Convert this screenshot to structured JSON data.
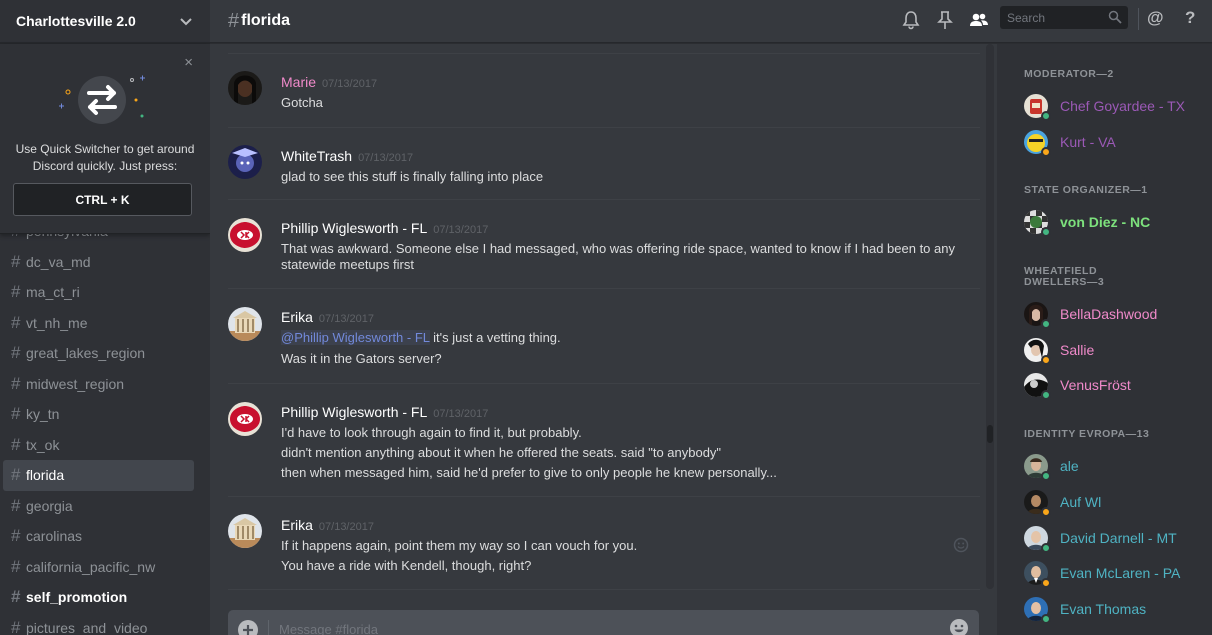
{
  "colors": {
    "online": "#43b581",
    "idle": "#faa61a",
    "moderator": "#9b59b6",
    "state_organizer": "#7de17d",
    "wheatfield": "#f08aca",
    "identity": "#4fb3c3",
    "marie": "#f08aca",
    "mention": "#7289da"
  },
  "guild": {
    "name": "Charlottesville 2.0",
    "chevron_icon": "chevron-down-icon"
  },
  "quick_switcher": {
    "close": "×",
    "text_line1": "Use Quick Switcher to get around",
    "text_line2": "Discord quickly. Just press:",
    "shortcut": "CTRL + K"
  },
  "channels": [
    {
      "name": "pennsylvania",
      "state": "normal"
    },
    {
      "name": "dc_va_md",
      "state": "normal"
    },
    {
      "name": "ma_ct_ri",
      "state": "normal"
    },
    {
      "name": "vt_nh_me",
      "state": "normal"
    },
    {
      "name": "great_lakes_region",
      "state": "normal"
    },
    {
      "name": "midwest_region",
      "state": "normal"
    },
    {
      "name": "ky_tn",
      "state": "normal"
    },
    {
      "name": "tx_ok",
      "state": "normal"
    },
    {
      "name": "florida",
      "state": "active"
    },
    {
      "name": "georgia",
      "state": "normal"
    },
    {
      "name": "carolinas",
      "state": "normal"
    },
    {
      "name": "california_pacific_nw",
      "state": "normal"
    },
    {
      "name": "self_promotion",
      "state": "unread"
    },
    {
      "name": "pictures_and_video",
      "state": "normal"
    }
  ],
  "header": {
    "hash": "#",
    "channel": "florida",
    "search_placeholder": "Search",
    "icons": [
      "bell-icon",
      "pin-icon",
      "members-icon",
      "search-icon",
      "mention-icon",
      "help-icon"
    ],
    "mention_symbol": "@",
    "help_symbol": "?"
  },
  "messages": [
    {
      "author": "Marie",
      "time": "07/13/2017",
      "avatar": "avatar-marie",
      "lines": [
        "Gotcha"
      ]
    },
    {
      "author": "WhiteTrash",
      "time": "07/13/2017",
      "avatar": "avatar-whitetrash",
      "lines": [
        "glad to see this stuff is finally falling into place"
      ]
    },
    {
      "author": "Phillip Wiglesworth - FL",
      "time": "07/13/2017",
      "avatar": "avatar-chiefs",
      "lines": [
        "That was awkward. Someone else I had messaged, who was offering ride space, wanted to know if I had been to any",
        "statewide meetups first"
      ]
    },
    {
      "author": "Erika",
      "time": "07/13/2017",
      "avatar": "avatar-erika",
      "mention": "@Phillip Wiglesworth - FL",
      "lines": [
        " it's just a vetting thing.",
        "Was it in the Gators server?"
      ]
    },
    {
      "author": "Phillip Wiglesworth - FL",
      "time": "07/13/2017",
      "avatar": "avatar-chiefs",
      "lines": [
        "I'd have to look through again to find it, but probably.",
        "didn't mention anything about it when he offered the seats.  said \"to anybody\"",
        "then when messaged him, said he'd prefer to give to only people he knew personally..."
      ]
    },
    {
      "author": "Erika",
      "time": "07/13/2017",
      "avatar": "avatar-erika",
      "lines": [
        "If it happens again, point them my way so I can vouch for you.",
        "You have a ride with Kendell, though, right?"
      ]
    }
  ],
  "composer": {
    "placeholder": "Message #florida"
  },
  "member_groups": [
    {
      "title": "MODERATOR—2",
      "members": [
        {
          "name": "Chef Goyardee - TX",
          "status": "online"
        },
        {
          "name": "Kurt - VA",
          "status": "idle"
        }
      ]
    },
    {
      "title": "STATE ORGANIZER—1",
      "members": [
        {
          "name": "von Diez - NC",
          "status": "online"
        }
      ]
    },
    {
      "title": "WHEATFIELD DWELLERS—3",
      "members": [
        {
          "name": "BellaDashwood",
          "status": "online"
        },
        {
          "name": "Sallie",
          "status": "idle"
        },
        {
          "name": "VenusFröst",
          "status": "online"
        }
      ]
    },
    {
      "title": "IDENTITY EVROPA—13",
      "members": [
        {
          "name": "ale",
          "status": "online"
        },
        {
          "name": "Auf Wl",
          "status": "idle"
        },
        {
          "name": "David Darnell - MT",
          "status": "online"
        },
        {
          "name": "Evan McLaren - PA",
          "status": "idle"
        },
        {
          "name": "Evan Thomas",
          "status": "online"
        }
      ]
    }
  ]
}
